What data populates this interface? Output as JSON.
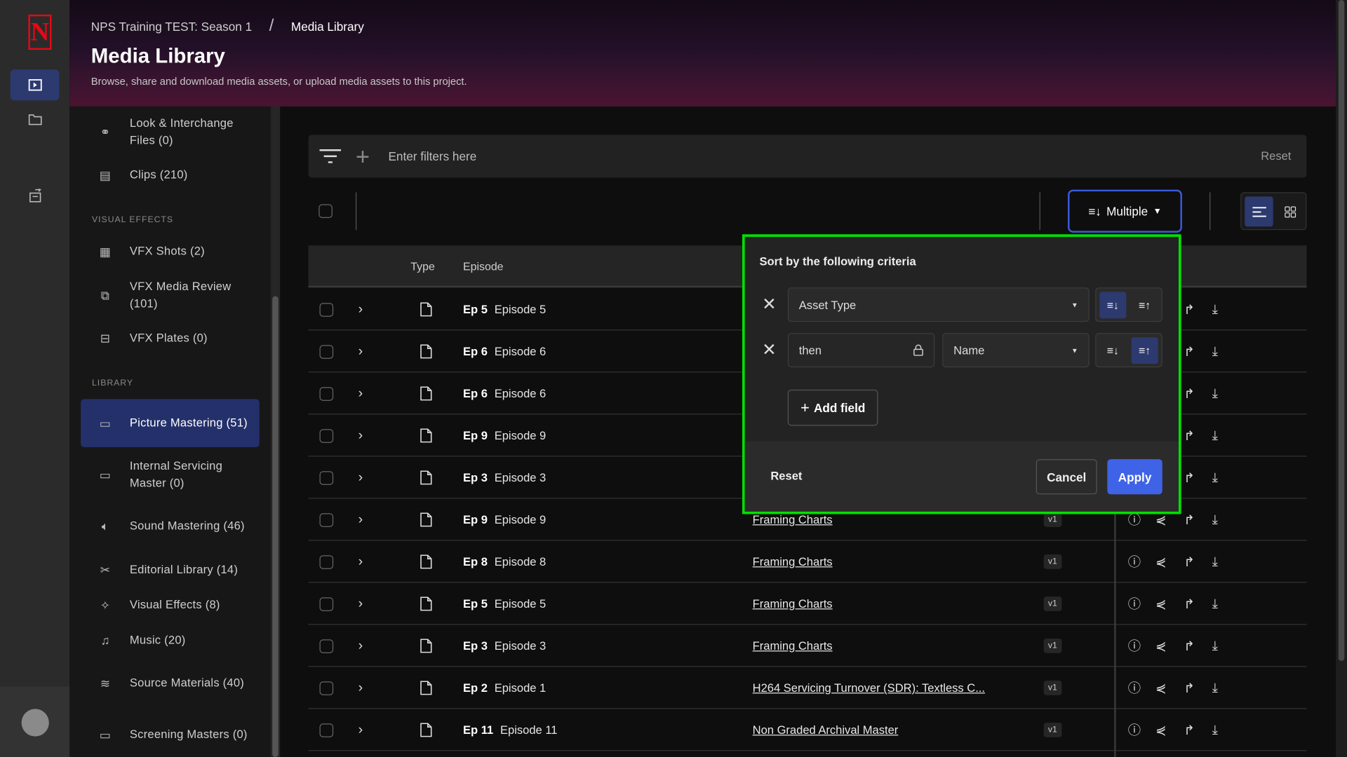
{
  "brand": {
    "logo_letter": "N",
    "accent": "#e50914",
    "active_color": "#2d3a70",
    "apply_color": "#3f63e6",
    "highlight_border": "#00e000"
  },
  "breadcrumb": {
    "project": "NPS Training TEST: Season 1",
    "separator": "/",
    "current": "Media Library"
  },
  "header": {
    "title": "Media Library",
    "subtitle": "Browse, share and download media assets, or upload media assets to this project."
  },
  "sidebar": {
    "items": [
      {
        "label": "Look & Interchange Files (0)",
        "icon": "color-circles-icon"
      },
      {
        "label": "Clips (210)",
        "icon": "film-icon"
      },
      {
        "label": "VFX Shots (2)",
        "icon": "vfx-shots-icon"
      },
      {
        "label": "VFX Media Review (101)",
        "icon": "media-review-icon"
      },
      {
        "label": "VFX Plates (0)",
        "icon": "plates-icon"
      },
      {
        "label": "Picture Mastering (51)",
        "icon": "monitor-icon",
        "active": true
      },
      {
        "label": "Internal Servicing Master (0)",
        "icon": "monitor-icon"
      },
      {
        "label": "Sound Mastering (46)",
        "icon": "speaker-icon"
      },
      {
        "label": "Editorial Library (14)",
        "icon": "scissors-icon"
      },
      {
        "label": "Visual Effects (8)",
        "icon": "sparkle-icon"
      },
      {
        "label": "Music (20)",
        "icon": "music-icon"
      },
      {
        "label": "Source Materials (40)",
        "icon": "source-icon"
      },
      {
        "label": "Screening Masters (0)",
        "icon": "monitor-icon"
      }
    ],
    "sections": {
      "visual_effects": "VISUAL EFFECTS",
      "library": "LIBRARY"
    }
  },
  "filter": {
    "placeholder": "Enter filters here",
    "reset": "Reset"
  },
  "toolbar": {
    "sort_label": "Multiple",
    "view": "list"
  },
  "table": {
    "columns": {
      "type": "Type",
      "episode": "Episode"
    },
    "rows": [
      {
        "ep": "Ep 5",
        "episode": "Episode 5",
        "name": "",
        "version": ""
      },
      {
        "ep": "Ep 6",
        "episode": "Episode 6",
        "name": "",
        "version": ""
      },
      {
        "ep": "Ep 6",
        "episode": "Episode 6",
        "name": "",
        "version": ""
      },
      {
        "ep": "Ep 9",
        "episode": "Episode 9",
        "name": "",
        "version": ""
      },
      {
        "ep": "Ep 3",
        "episode": "Episode 3",
        "name": "",
        "version": ""
      },
      {
        "ep": "Ep 9",
        "episode": "Episode 9",
        "name": "Framing Charts",
        "version": "v1"
      },
      {
        "ep": "Ep 8",
        "episode": "Episode 8",
        "name": "Framing Charts",
        "version": "v1"
      },
      {
        "ep": "Ep 5",
        "episode": "Episode 5",
        "name": "Framing Charts",
        "version": "v1"
      },
      {
        "ep": "Ep 3",
        "episode": "Episode 3",
        "name": "Framing Charts",
        "version": "v1"
      },
      {
        "ep": "Ep 2",
        "episode": "Episode 1",
        "name": "H264 Servicing Turnover (SDR): Textless C...",
        "version": "v1"
      },
      {
        "ep": "Ep 11",
        "episode": "Episode 11",
        "name": "Non Graded Archival Master",
        "version": "v1"
      }
    ]
  },
  "sort_popover": {
    "title": "Sort by the following criteria",
    "criteria": [
      {
        "field": "Asset Type",
        "direction": "descending"
      },
      {
        "prefix": "then",
        "field": "Name",
        "direction": "ascending"
      }
    ],
    "add_field": "Add field",
    "reset": "Reset",
    "cancel": "Cancel",
    "apply": "Apply"
  }
}
